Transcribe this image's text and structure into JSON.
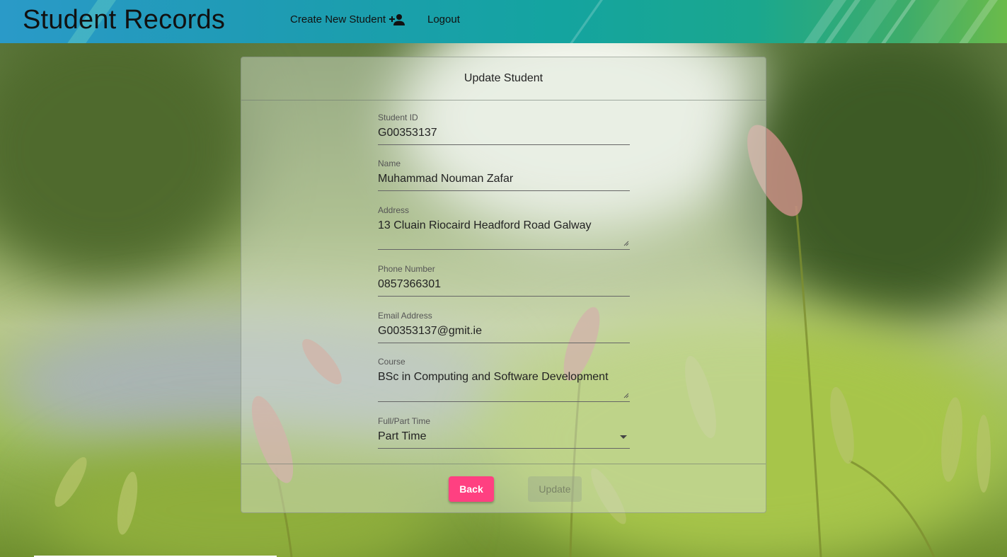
{
  "header": {
    "app_title": "Student Records",
    "nav": {
      "create_label": "Create New Student",
      "create_icon": "person-add-icon",
      "logout_label": "Logout"
    }
  },
  "form": {
    "title": "Update Student",
    "fields": {
      "student_id": {
        "label": "Student ID",
        "value": "G00353137"
      },
      "name": {
        "label": "Name",
        "value": "Muhammad Nouman Zafar"
      },
      "address": {
        "label": "Address",
        "value": "13 Cluain Riocaird Headford Road Galway"
      },
      "phone": {
        "label": "Phone Number",
        "value": "0857366301"
      },
      "email": {
        "label": "Email Address",
        "value": "G00353137@gmit.ie"
      },
      "course": {
        "label": "Course",
        "value": "BSc in Computing and Software Development"
      },
      "attendance": {
        "label": "Full/Part Time",
        "value": "Part Time"
      }
    },
    "buttons": {
      "back_label": "Back",
      "update_label": "Update"
    }
  },
  "colors": {
    "accent_pink": "#ff4081",
    "header_gradient_start": "#2a9ac8",
    "header_gradient_end": "#6bbb4a"
  }
}
